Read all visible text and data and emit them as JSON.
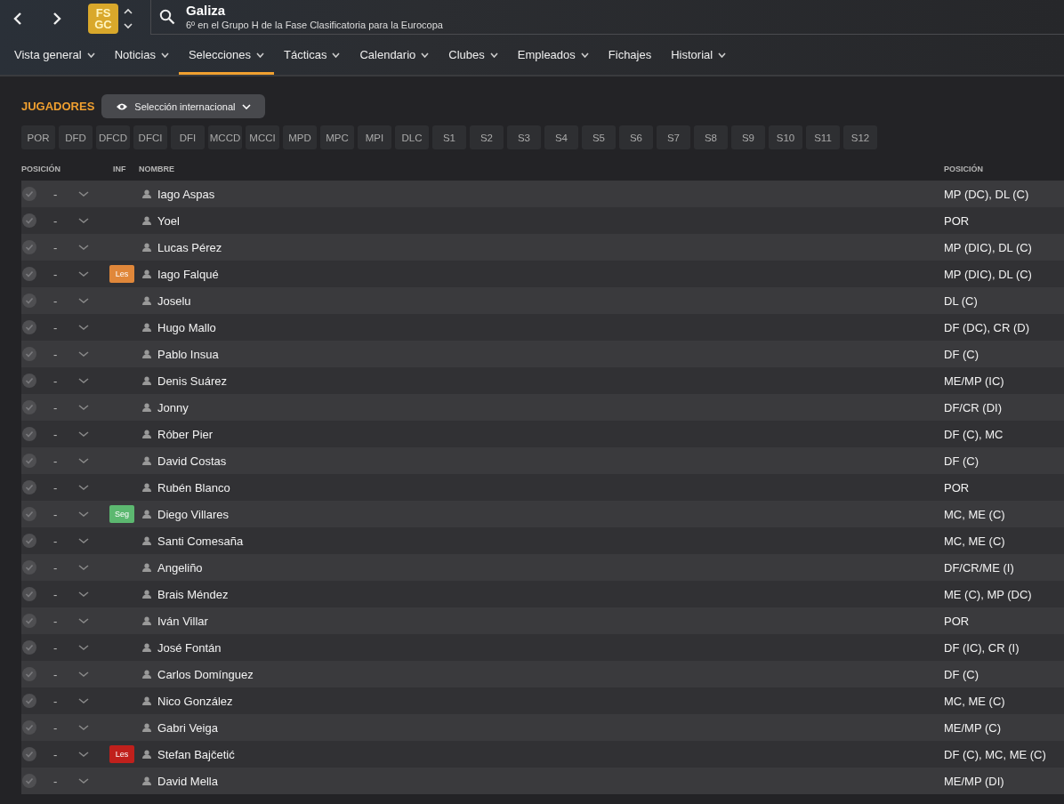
{
  "header": {
    "logo": {
      "top": "FS",
      "bottom": "GC"
    },
    "title": "Galiza",
    "subtitle": "6º en el Grupo H de la Fase Clasificatoria para la Eurocopa"
  },
  "nav": [
    {
      "label": "Vista general",
      "menu": true,
      "selected": false
    },
    {
      "label": "Noticias",
      "menu": true,
      "selected": false
    },
    {
      "label": "Selecciones",
      "menu": true,
      "selected": true
    },
    {
      "label": "Tácticas",
      "menu": true,
      "selected": false
    },
    {
      "label": "Calendario",
      "menu": true,
      "selected": false
    },
    {
      "label": "Clubes",
      "menu": true,
      "selected": false
    },
    {
      "label": "Empleados",
      "menu": true,
      "selected": false
    },
    {
      "label": "Fichajes",
      "menu": false,
      "selected": false
    },
    {
      "label": "Historial",
      "menu": true,
      "selected": false
    }
  ],
  "section": {
    "title": "JUGADORES",
    "view_button": "Selección internacional"
  },
  "position_filters": [
    "POR",
    "DFD",
    "DFCD",
    "DFCI",
    "DFI",
    "MCCD",
    "MCCI",
    "MPD",
    "MPC",
    "MPI",
    "DLC",
    "S1",
    "S2",
    "S3",
    "S4",
    "S5",
    "S6",
    "S7",
    "S8",
    "S9",
    "S10",
    "S11",
    "S12"
  ],
  "table": {
    "columns": [
      "POSICIÓN",
      "INF",
      "NOMBRE",
      "POSICIÓN"
    ],
    "rows": [
      {
        "slot": "-",
        "name": "Iago Aspas",
        "position": "MP (DC), DL (C)"
      },
      {
        "slot": "-",
        "name": "Yoel",
        "position": "POR"
      },
      {
        "slot": "-",
        "name": "Lucas Pérez",
        "position": "MP (DIC), DL (C)"
      },
      {
        "slot": "-",
        "badge": {
          "text": "Les",
          "color": "#e0873a"
        },
        "name": "Iago Falqué",
        "position": "MP (DIC), DL (C)"
      },
      {
        "slot": "-",
        "name": "Joselu",
        "position": "DL (C)"
      },
      {
        "slot": "-",
        "name": "Hugo Mallo",
        "position": "DF (DC), CR (D)"
      },
      {
        "slot": "-",
        "name": "Pablo Insua",
        "position": "DF (C)"
      },
      {
        "slot": "-",
        "name": "Denis Suárez",
        "position": "ME/MP (IC)"
      },
      {
        "slot": "-",
        "name": "Jonny",
        "position": "DF/CR (DI)"
      },
      {
        "slot": "-",
        "name": "Róber Pier",
        "position": "DF (C), MC"
      },
      {
        "slot": "-",
        "name": "David Costas",
        "position": "DF (C)"
      },
      {
        "slot": "-",
        "name": "Rubén Blanco",
        "position": "POR"
      },
      {
        "slot": "-",
        "badge": {
          "text": "Seg",
          "color": "#5cb870"
        },
        "name": "Diego Villares",
        "position": "MC, ME (C)"
      },
      {
        "slot": "-",
        "name": "Santi Comesaña",
        "position": "MC, ME (C)"
      },
      {
        "slot": "-",
        "name": "Angeliño",
        "position": "DF/CR/ME (I)"
      },
      {
        "slot": "-",
        "name": "Brais Méndez",
        "position": "ME (C), MP (DC)"
      },
      {
        "slot": "-",
        "name": "Iván Villar",
        "position": "POR"
      },
      {
        "slot": "-",
        "name": "José Fontán",
        "position": "DF (IC), CR (I)"
      },
      {
        "slot": "-",
        "name": "Carlos Domínguez",
        "position": "DF (C)"
      },
      {
        "slot": "-",
        "name": "Nico González",
        "position": "MC, ME (C)"
      },
      {
        "slot": "-",
        "name": "Gabri Veiga",
        "position": "ME/MP (C)"
      },
      {
        "slot": "-",
        "badge": {
          "text": "Les",
          "color": "#c0201c"
        },
        "name": "Stefan Bajčetić",
        "position": "DF (C), MC, ME (C)"
      },
      {
        "slot": "-",
        "name": "David Mella",
        "position": "ME/MP (DI)"
      }
    ]
  }
}
